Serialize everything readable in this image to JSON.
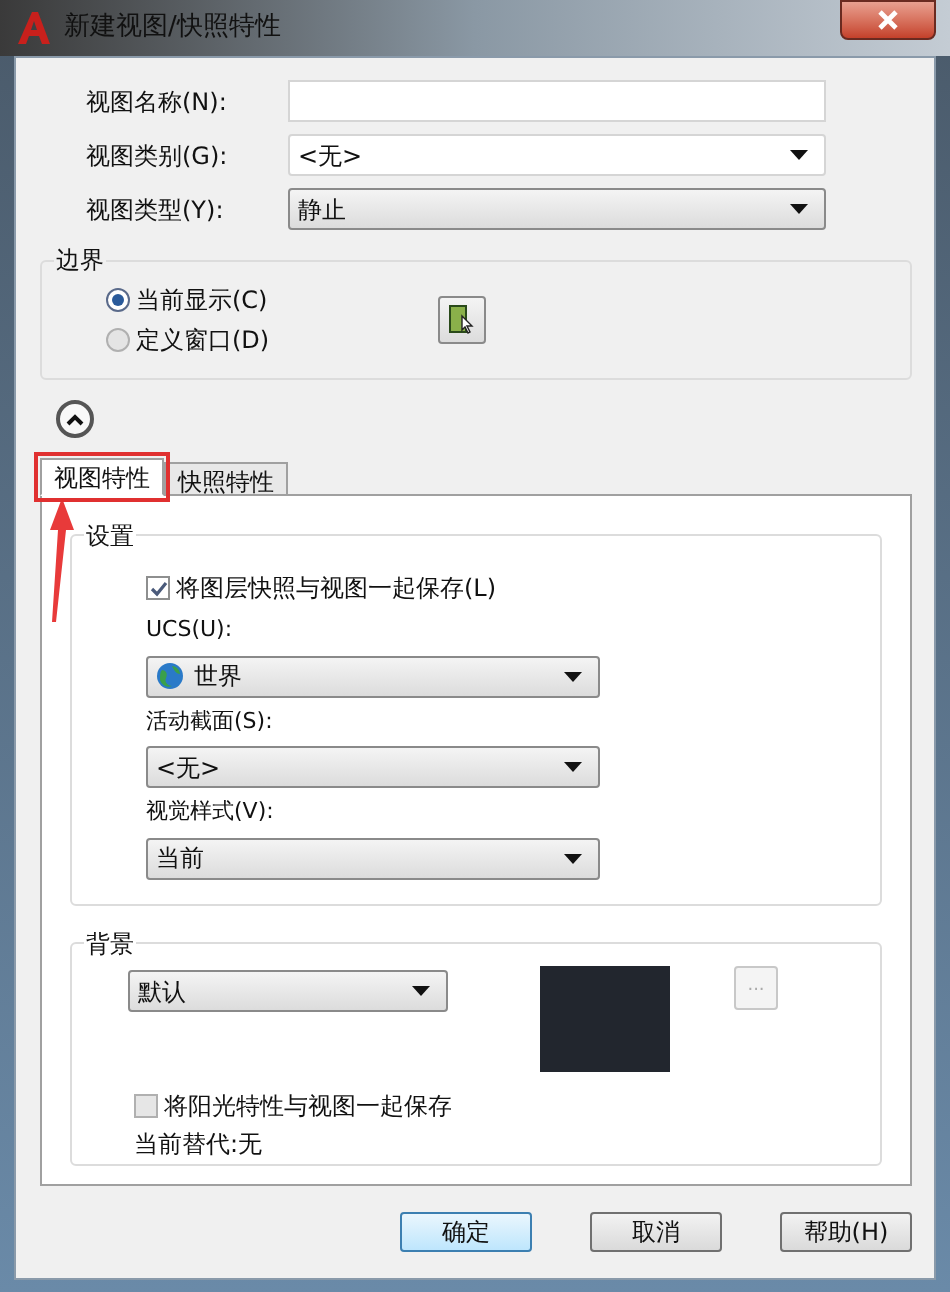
{
  "window": {
    "title": "新建视图/快照特性"
  },
  "fields": [
    {
      "label": "视图名称(N):",
      "kind": "text"
    },
    {
      "label": "视图类别(G):",
      "kind": "editable",
      "value": "<无>"
    },
    {
      "label": "视图类型(Y):",
      "kind": "dropdown",
      "value": "静止"
    }
  ],
  "boundary": {
    "title": "边界",
    "options": [
      {
        "label": "当前显示(C)",
        "selected": true
      },
      {
        "label": "定义窗口(D)",
        "selected": false
      }
    ]
  },
  "tabs": [
    {
      "label": "视图特性",
      "selected": true
    },
    {
      "label": "快照特性",
      "selected": false
    }
  ],
  "settings": {
    "title": "设置",
    "save_layers": {
      "label": "将图层快照与视图一起保存(L)",
      "checked": true
    },
    "selects": [
      {
        "label": "UCS(U):",
        "value": "世界",
        "kind": "globe"
      },
      {
        "label": "活动截面(S):",
        "value": "<无>",
        "kind": "plain"
      },
      {
        "label": "视觉样式(V):",
        "value": "当前",
        "kind": "plain"
      }
    ]
  },
  "background": {
    "title": "背景",
    "value": "默认",
    "more": "...",
    "save_sun": {
      "label": "将阳光特性与视图一起保存",
      "checked": false
    },
    "override": "当前替代:无"
  },
  "buttons": [
    {
      "label": "确定",
      "default": true
    },
    {
      "label": "取消",
      "default": false
    },
    {
      "label": "帮助(H)",
      "default": false
    }
  ]
}
